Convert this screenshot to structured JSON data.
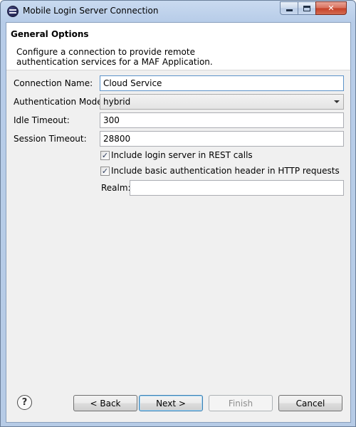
{
  "window": {
    "title": "Mobile Login Server Connection",
    "controls": {
      "minimize": "minimize-icon",
      "maximize": "maximize-icon",
      "close": "close-icon"
    }
  },
  "header": {
    "title": "General Options",
    "description": "Configure a connection to provide remote authentication services for a MAF Application."
  },
  "form": {
    "connection_name": {
      "label": "Connection Name:",
      "value": "Cloud Service"
    },
    "auth_mode": {
      "label": "Authentication Mode:",
      "value": "hybrid"
    },
    "idle_timeout": {
      "label": "Idle Timeout:",
      "value": "300"
    },
    "session_timeout": {
      "label": "Session Timeout:",
      "value": "28800"
    },
    "include_login_server": {
      "label": "Include login server in REST calls",
      "checked": true
    },
    "include_basic_auth": {
      "label": "Include basic authentication header in HTTP requests",
      "checked": true
    },
    "realm": {
      "label": "Realm:",
      "value": ""
    }
  },
  "buttons": {
    "help": "?",
    "back": "< Back",
    "next": "Next >",
    "finish": "Finish",
    "cancel": "Cancel"
  },
  "colors": {
    "titlebar": "#b7cce8",
    "close_button": "#c54027",
    "dialog_background": "#f0f0f0",
    "default_button_border": "#3c7fb1"
  }
}
